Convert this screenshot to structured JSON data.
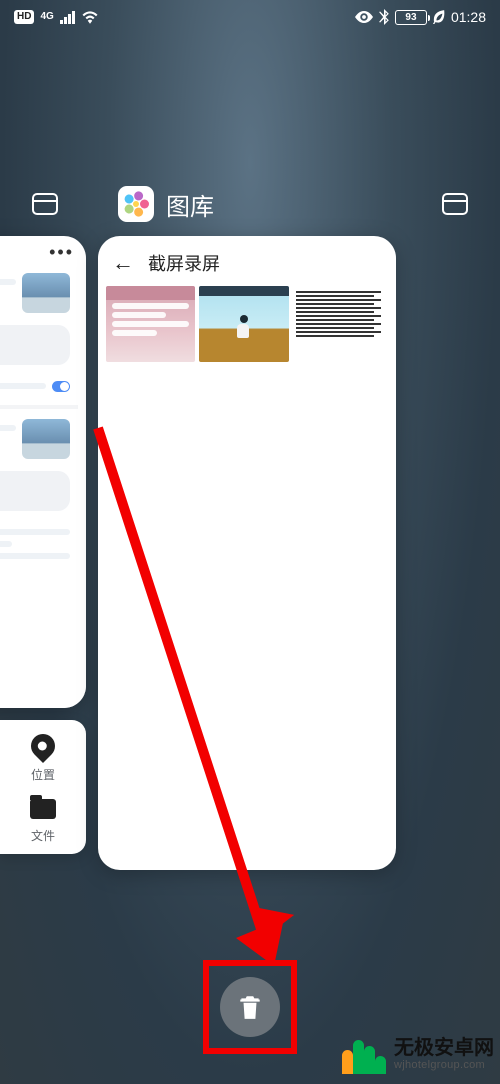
{
  "status": {
    "hd": "HD",
    "net": "4G",
    "battery": "93",
    "time": "01:28"
  },
  "recents": {
    "app_name": "图库"
  },
  "gallery_card": {
    "title": "截屏录屏"
  },
  "float_panel": {
    "location_label": "位置",
    "file_label": "文件"
  },
  "watermark": {
    "name": "无极安卓网",
    "url": "wjhotelgroup.com"
  }
}
